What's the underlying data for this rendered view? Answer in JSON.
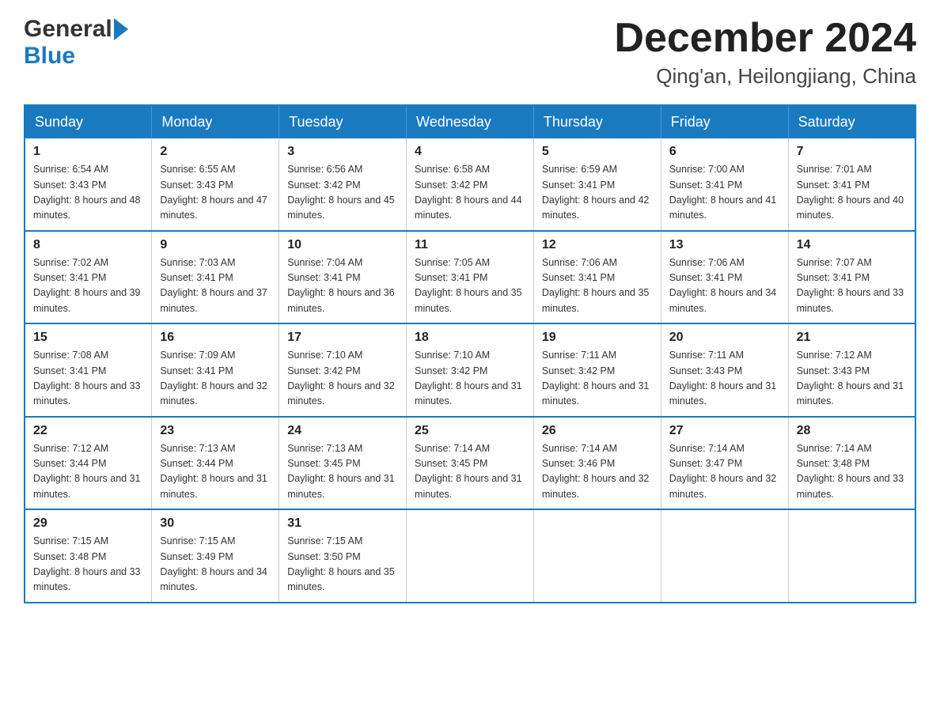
{
  "header": {
    "logo_general": "General",
    "logo_blue": "Blue",
    "month_title": "December 2024",
    "location": "Qing'an, Heilongjiang, China"
  },
  "days_of_week": [
    "Sunday",
    "Monday",
    "Tuesday",
    "Wednesday",
    "Thursday",
    "Friday",
    "Saturday"
  ],
  "weeks": [
    [
      {
        "day": "1",
        "sunrise": "6:54 AM",
        "sunset": "3:43 PM",
        "daylight": "8 hours and 48 minutes."
      },
      {
        "day": "2",
        "sunrise": "6:55 AM",
        "sunset": "3:43 PM",
        "daylight": "8 hours and 47 minutes."
      },
      {
        "day": "3",
        "sunrise": "6:56 AM",
        "sunset": "3:42 PM",
        "daylight": "8 hours and 45 minutes."
      },
      {
        "day": "4",
        "sunrise": "6:58 AM",
        "sunset": "3:42 PM",
        "daylight": "8 hours and 44 minutes."
      },
      {
        "day": "5",
        "sunrise": "6:59 AM",
        "sunset": "3:41 PM",
        "daylight": "8 hours and 42 minutes."
      },
      {
        "day": "6",
        "sunrise": "7:00 AM",
        "sunset": "3:41 PM",
        "daylight": "8 hours and 41 minutes."
      },
      {
        "day": "7",
        "sunrise": "7:01 AM",
        "sunset": "3:41 PM",
        "daylight": "8 hours and 40 minutes."
      }
    ],
    [
      {
        "day": "8",
        "sunrise": "7:02 AM",
        "sunset": "3:41 PM",
        "daylight": "8 hours and 39 minutes."
      },
      {
        "day": "9",
        "sunrise": "7:03 AM",
        "sunset": "3:41 PM",
        "daylight": "8 hours and 37 minutes."
      },
      {
        "day": "10",
        "sunrise": "7:04 AM",
        "sunset": "3:41 PM",
        "daylight": "8 hours and 36 minutes."
      },
      {
        "day": "11",
        "sunrise": "7:05 AM",
        "sunset": "3:41 PM",
        "daylight": "8 hours and 35 minutes."
      },
      {
        "day": "12",
        "sunrise": "7:06 AM",
        "sunset": "3:41 PM",
        "daylight": "8 hours and 35 minutes."
      },
      {
        "day": "13",
        "sunrise": "7:06 AM",
        "sunset": "3:41 PM",
        "daylight": "8 hours and 34 minutes."
      },
      {
        "day": "14",
        "sunrise": "7:07 AM",
        "sunset": "3:41 PM",
        "daylight": "8 hours and 33 minutes."
      }
    ],
    [
      {
        "day": "15",
        "sunrise": "7:08 AM",
        "sunset": "3:41 PM",
        "daylight": "8 hours and 33 minutes."
      },
      {
        "day": "16",
        "sunrise": "7:09 AM",
        "sunset": "3:41 PM",
        "daylight": "8 hours and 32 minutes."
      },
      {
        "day": "17",
        "sunrise": "7:10 AM",
        "sunset": "3:42 PM",
        "daylight": "8 hours and 32 minutes."
      },
      {
        "day": "18",
        "sunrise": "7:10 AM",
        "sunset": "3:42 PM",
        "daylight": "8 hours and 31 minutes."
      },
      {
        "day": "19",
        "sunrise": "7:11 AM",
        "sunset": "3:42 PM",
        "daylight": "8 hours and 31 minutes."
      },
      {
        "day": "20",
        "sunrise": "7:11 AM",
        "sunset": "3:43 PM",
        "daylight": "8 hours and 31 minutes."
      },
      {
        "day": "21",
        "sunrise": "7:12 AM",
        "sunset": "3:43 PM",
        "daylight": "8 hours and 31 minutes."
      }
    ],
    [
      {
        "day": "22",
        "sunrise": "7:12 AM",
        "sunset": "3:44 PM",
        "daylight": "8 hours and 31 minutes."
      },
      {
        "day": "23",
        "sunrise": "7:13 AM",
        "sunset": "3:44 PM",
        "daylight": "8 hours and 31 minutes."
      },
      {
        "day": "24",
        "sunrise": "7:13 AM",
        "sunset": "3:45 PM",
        "daylight": "8 hours and 31 minutes."
      },
      {
        "day": "25",
        "sunrise": "7:14 AM",
        "sunset": "3:45 PM",
        "daylight": "8 hours and 31 minutes."
      },
      {
        "day": "26",
        "sunrise": "7:14 AM",
        "sunset": "3:46 PM",
        "daylight": "8 hours and 32 minutes."
      },
      {
        "day": "27",
        "sunrise": "7:14 AM",
        "sunset": "3:47 PM",
        "daylight": "8 hours and 32 minutes."
      },
      {
        "day": "28",
        "sunrise": "7:14 AM",
        "sunset": "3:48 PM",
        "daylight": "8 hours and 33 minutes."
      }
    ],
    [
      {
        "day": "29",
        "sunrise": "7:15 AM",
        "sunset": "3:48 PM",
        "daylight": "8 hours and 33 minutes."
      },
      {
        "day": "30",
        "sunrise": "7:15 AM",
        "sunset": "3:49 PM",
        "daylight": "8 hours and 34 minutes."
      },
      {
        "day": "31",
        "sunrise": "7:15 AM",
        "sunset": "3:50 PM",
        "daylight": "8 hours and 35 minutes."
      },
      null,
      null,
      null,
      null
    ]
  ]
}
